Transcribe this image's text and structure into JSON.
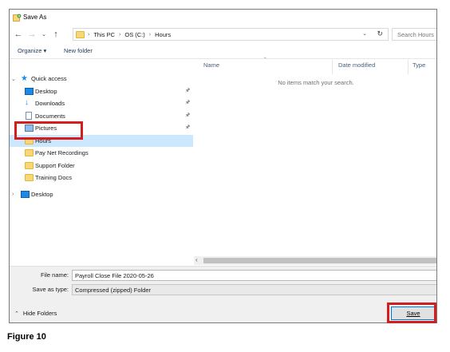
{
  "window": {
    "title": "Save As"
  },
  "nav": {
    "back_icon": "arrow-left-icon",
    "forward_icon": "arrow-right-icon",
    "recent_icon": "chevron-down-icon",
    "up_icon": "arrow-up-icon",
    "breadcrumb": [
      "This PC",
      "OS (C:)",
      "Hours"
    ],
    "refresh_icon": "refresh-icon",
    "search_placeholder": "Search Hours"
  },
  "toolbar": {
    "organize": "Organize ▾",
    "new_folder": "New folder"
  },
  "sidebar": {
    "quick_access": "Quick access",
    "items": [
      {
        "label": "Desktop",
        "icon": "desktop-icon",
        "pinned": true
      },
      {
        "label": "Downloads",
        "icon": "download-icon",
        "pinned": true
      },
      {
        "label": "Documents",
        "icon": "document-icon",
        "pinned": true
      },
      {
        "label": "Pictures",
        "icon": "pictures-icon",
        "pinned": true
      },
      {
        "label": "Hours",
        "icon": "folder-icon",
        "selected": true
      },
      {
        "label": "Pay Net Recordings",
        "icon": "folder-icon"
      },
      {
        "label": "Support Folder",
        "icon": "folder-icon"
      },
      {
        "label": "Training Docs",
        "icon": "folder-icon"
      }
    ],
    "desktop_root": "Desktop"
  },
  "content": {
    "columns": [
      "Name",
      "Date modified",
      "Type"
    ],
    "empty_message": "No items match your search."
  },
  "form": {
    "file_name_label": "File name:",
    "file_name_value": "Payroll Close File 2020-05-26",
    "save_type_label": "Save as type:",
    "save_type_value": "Compressed (zipped) Folder"
  },
  "footer": {
    "hide_folders": "Hide Folders",
    "save": "Save"
  },
  "caption": "Figure 10",
  "colors": {
    "highlight": "#d61d1d",
    "selection": "#cce8ff",
    "accent": "#0078d7"
  }
}
